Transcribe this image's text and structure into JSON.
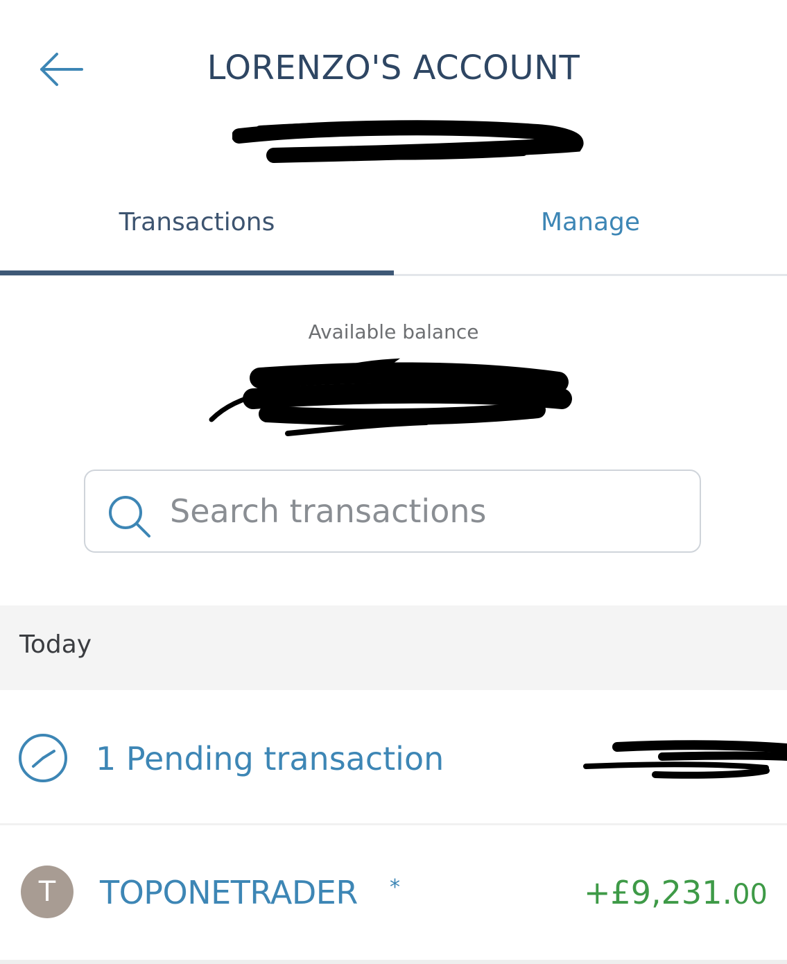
{
  "header": {
    "title": "LORENZO'S ACCOUNT",
    "back_icon": "arrow-left-icon"
  },
  "tabs": [
    {
      "label": "Transactions",
      "active": true
    },
    {
      "label": "Manage",
      "active": false
    }
  ],
  "balance": {
    "label": "Available balance"
  },
  "search": {
    "placeholder": "Search transactions",
    "value": "",
    "icon": "search-icon"
  },
  "sections": [
    {
      "label": "Today",
      "pending": {
        "label": "1 Pending transaction",
        "icon": "clock-icon"
      },
      "transactions": [
        {
          "avatar_letter": "T",
          "merchant": "TOPONETRADER",
          "flag": "*",
          "amount_main": "+£9,231.",
          "amount_pence": "00"
        }
      ]
    }
  ],
  "colors": {
    "accent_blue": "#3d86b5",
    "title_navy": "#2e4663",
    "positive_green": "#3e9a47",
    "avatar_bg": "#a89c93",
    "section_bg": "#f4f4f4"
  }
}
